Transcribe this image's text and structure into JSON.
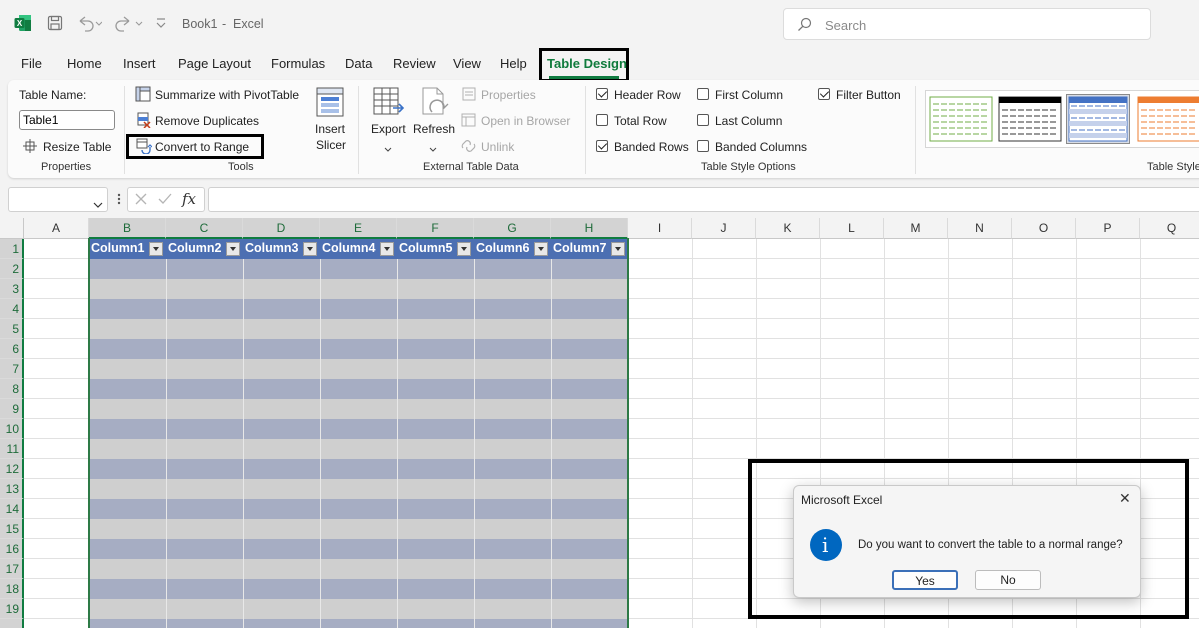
{
  "titlebar": {
    "filename": "Book1",
    "separator": "-",
    "app": "Excel",
    "search_placeholder": "Search"
  },
  "tabs": [
    "File",
    "Home",
    "Insert",
    "Page Layout",
    "Formulas",
    "Data",
    "Review",
    "View",
    "Help",
    "Table Design"
  ],
  "active_tab": "Table Design",
  "ribbon": {
    "properties": {
      "table_name_label": "Table Name:",
      "table_name_value": "Table1",
      "resize": "Resize Table",
      "group": "Properties"
    },
    "tools": {
      "summarize": "Summarize with PivotTable",
      "remove_dups": "Remove Duplicates",
      "convert": "Convert to Range",
      "insert_slicer_1": "Insert",
      "insert_slicer_2": "Slicer",
      "group": "Tools"
    },
    "external": {
      "export": "Export",
      "refresh": "Refresh",
      "properties": "Properties",
      "open_browser": "Open in Browser",
      "unlink": "Unlink",
      "group": "External Table Data"
    },
    "style_options": {
      "options": [
        {
          "label": "Header Row",
          "checked": true
        },
        {
          "label": "Total Row",
          "checked": false
        },
        {
          "label": "Banded Rows",
          "checked": true
        },
        {
          "label": "First Column",
          "checked": false
        },
        {
          "label": "Last Column",
          "checked": false
        },
        {
          "label": "Banded Columns",
          "checked": false
        },
        {
          "label": "Filter Button",
          "checked": true
        }
      ],
      "group": "Table Style Options"
    },
    "table_styles": {
      "group": "Table Style"
    }
  },
  "formula_bar": {
    "fx": "fx"
  },
  "columns": [
    "A",
    "B",
    "C",
    "D",
    "E",
    "F",
    "G",
    "H",
    "I",
    "J",
    "K",
    "L",
    "M",
    "N",
    "O",
    "P",
    "Q"
  ],
  "rows": [
    "1",
    "2",
    "3",
    "4",
    "5",
    "6",
    "7",
    "8",
    "9",
    "10",
    "11",
    "12",
    "13",
    "14",
    "15",
    "16",
    "17",
    "18",
    "19"
  ],
  "table_headers": [
    "Column1",
    "Column2",
    "Column3",
    "Column4",
    "Column5",
    "Column6",
    "Column7"
  ],
  "dialog": {
    "title": "Microsoft Excel",
    "message": "Do you want to convert the table to a normal range?",
    "yes": "Yes",
    "no": "No",
    "close": "✕",
    "info": "i"
  },
  "colors": {
    "accent": "#107c41",
    "table_header": "#4c6fb2",
    "band_dark": "#a6adc3",
    "band_light": "#cfcfcf",
    "info_blue": "#0067c0"
  }
}
